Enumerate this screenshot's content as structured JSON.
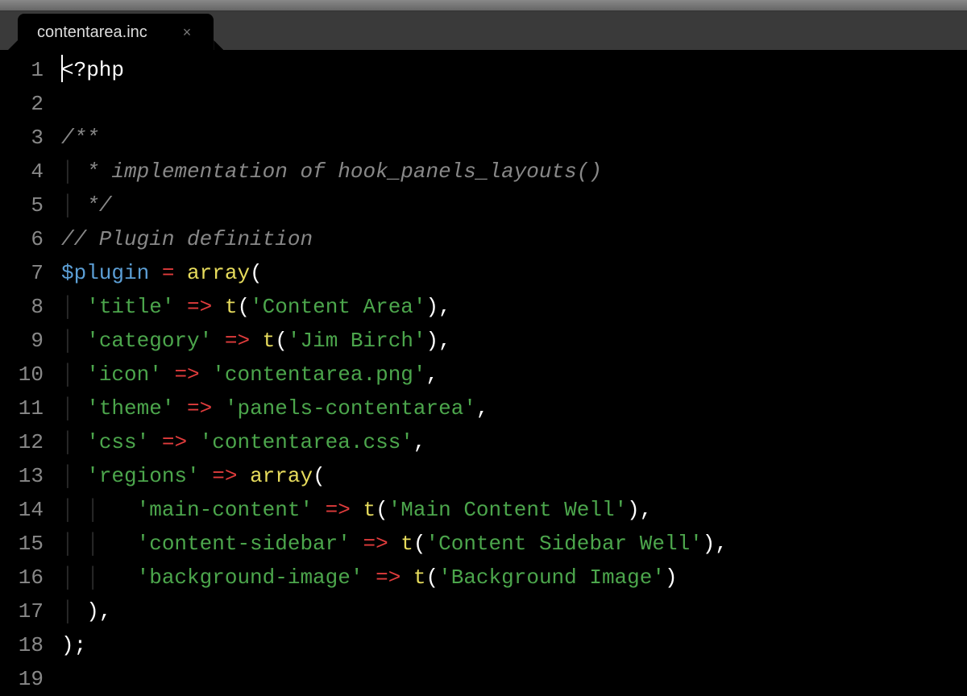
{
  "tab": {
    "filename": "contentarea.inc"
  },
  "gutter": {
    "lines": [
      "1",
      "2",
      "3",
      "4",
      "5",
      "6",
      "7",
      "8",
      "9",
      "10",
      "11",
      "12",
      "13",
      "14",
      "15",
      "16",
      "17",
      "18",
      "19"
    ]
  },
  "code": {
    "l1_open": "<?php",
    "l3_cmt": "/**",
    "l4_cmt": " * implementation of hook_panels_layouts()",
    "l5_cmt": " */",
    "l6_cmt": "// Plugin definition",
    "l7_var": "$plugin",
    "l7_eq": " = ",
    "l7_arr": "array",
    "l7_paren": "(",
    "l8_key": "'title'",
    "arrow": " => ",
    "t": "t",
    "op": "(",
    "cp": ")",
    "comma": ",",
    "l8_val": "'Content Area'",
    "l9_key": "'category'",
    "l9_val": "'Jim Birch'",
    "l10_key": "'icon'",
    "l10_val": "'contentarea.png'",
    "l11_key": "'theme'",
    "l11_val": "'panels-contentarea'",
    "l12_key": "'css'",
    "l12_val": "'contentarea.css'",
    "l13_key": "'regions'",
    "l13_arr": "array",
    "l14_key": "'main-content'",
    "l14_val": "'Main Content Well'",
    "l15_key": "'content-sidebar'",
    "l15_val": "'Content Sidebar Well'",
    "l16_key": "'background-image'",
    "l16_val": "'Background Image'",
    "l17_close": "),",
    "l18_close": ");"
  }
}
